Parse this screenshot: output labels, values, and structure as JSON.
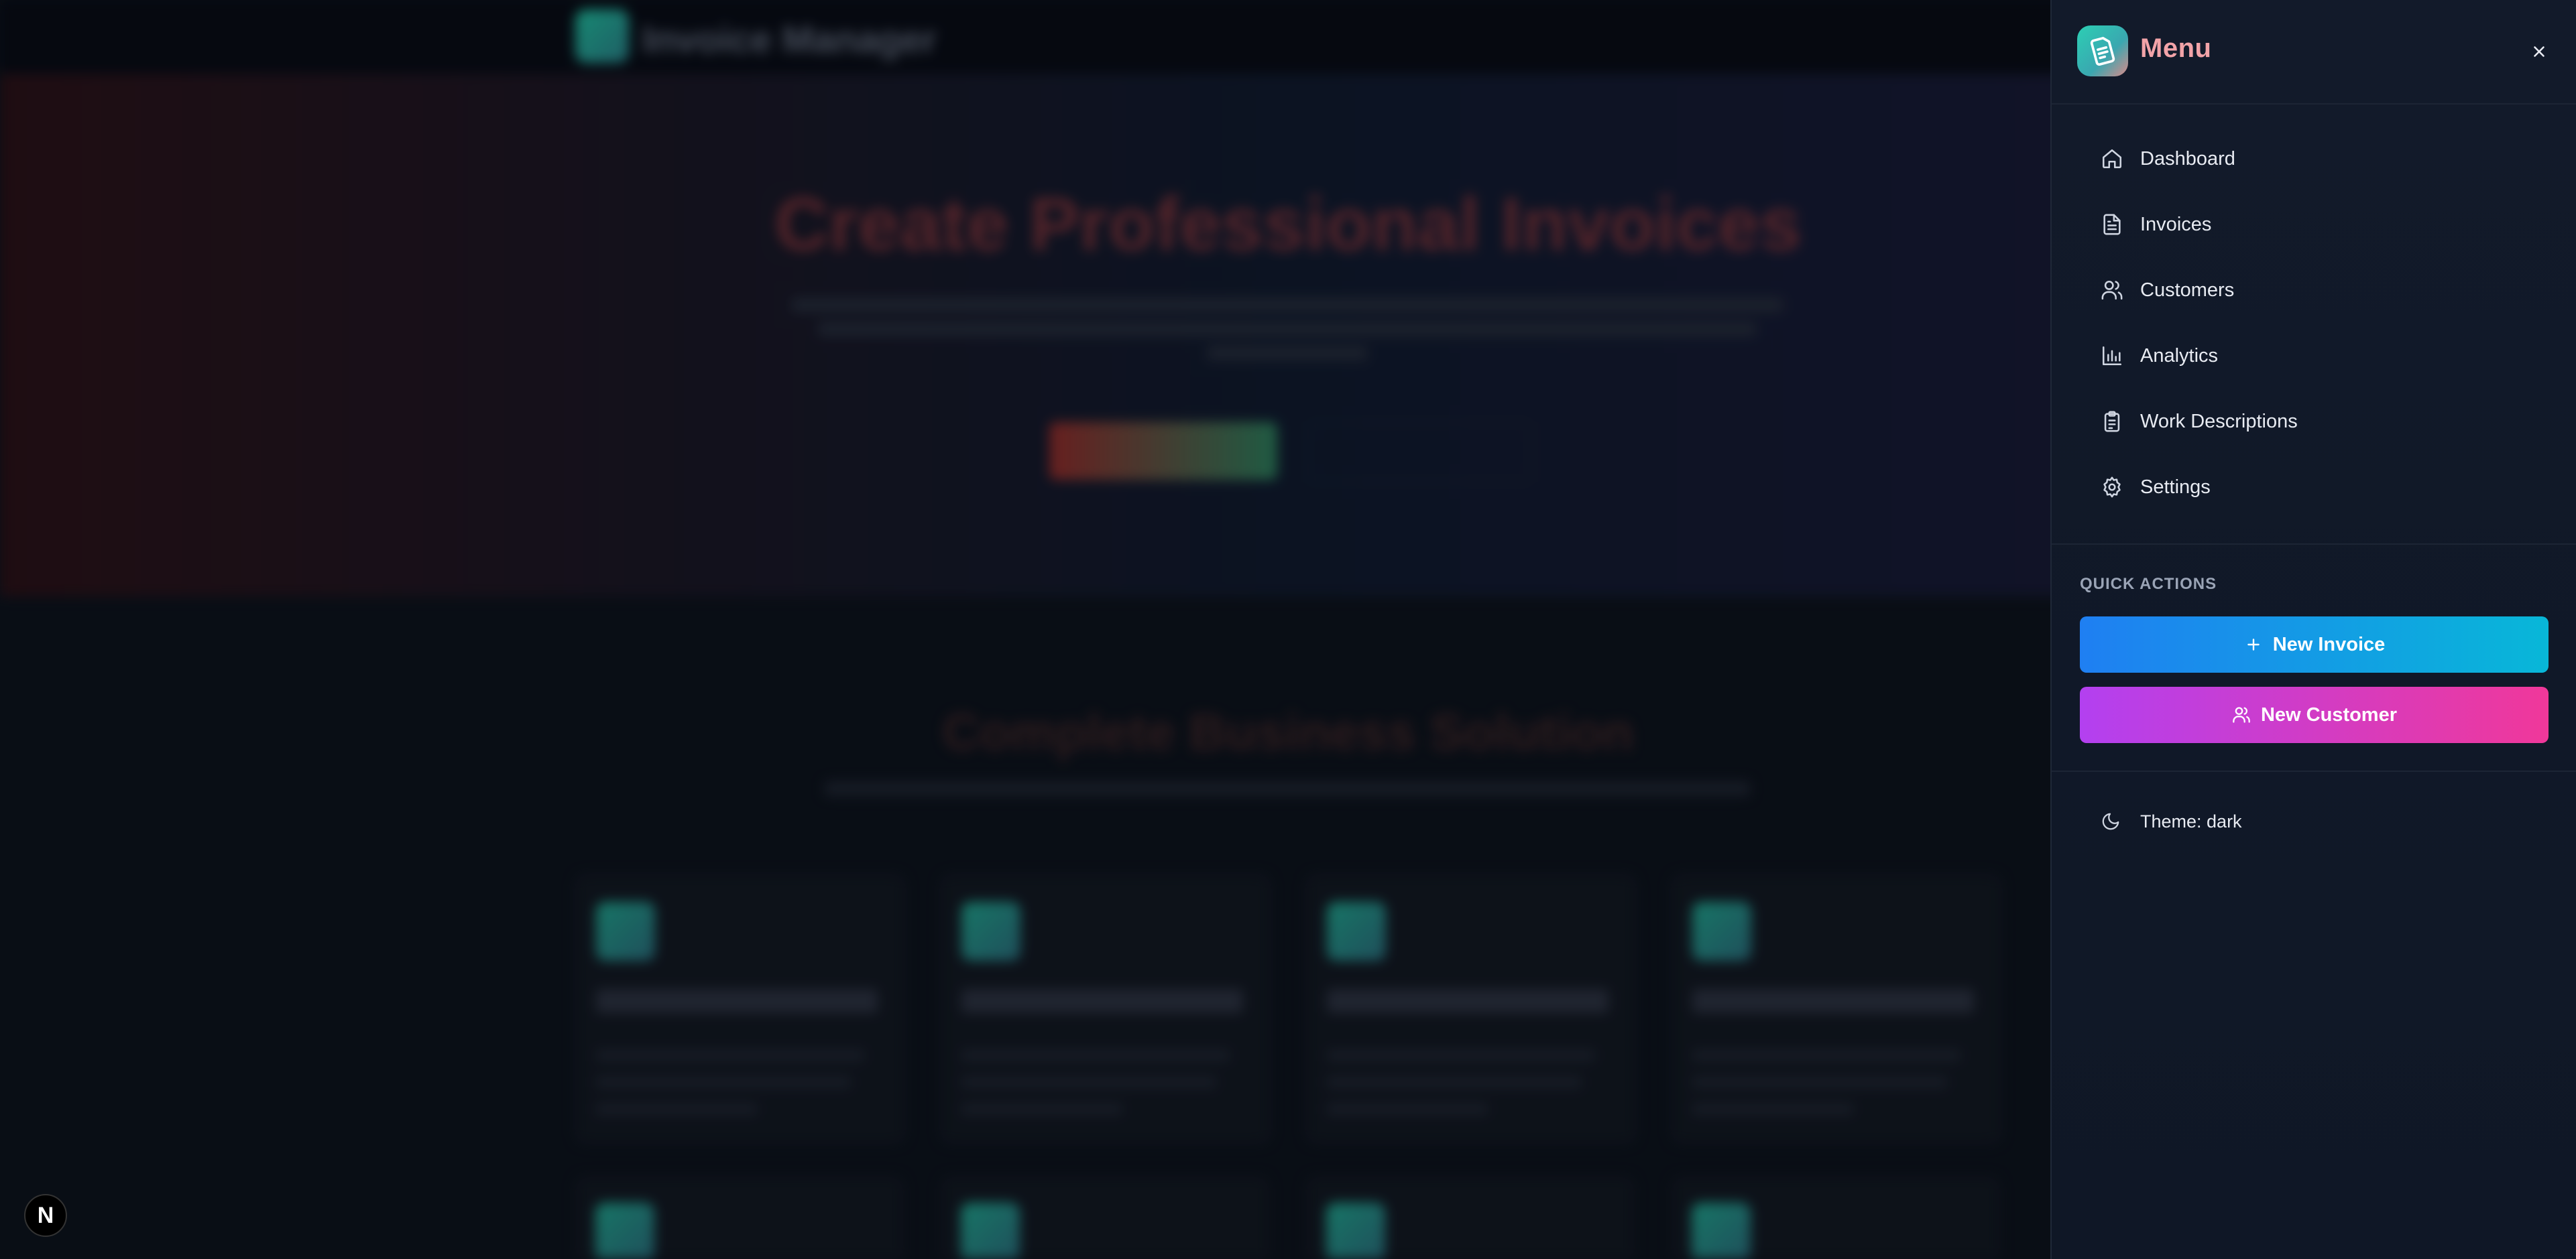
{
  "background": {
    "brand": "Invoice Manager",
    "hero_title": "Create Professional Invoices",
    "section_title": "Complete Business Solution"
  },
  "drawer": {
    "title": "Menu",
    "close_icon": "close-icon",
    "nav_items": [
      {
        "label": "Dashboard",
        "icon": "home-icon"
      },
      {
        "label": "Invoices",
        "icon": "file-text-icon"
      },
      {
        "label": "Customers",
        "icon": "users-icon"
      },
      {
        "label": "Analytics",
        "icon": "bar-chart-icon"
      },
      {
        "label": "Work Descriptions",
        "icon": "clipboard-icon"
      },
      {
        "label": "Settings",
        "icon": "gear-icon"
      }
    ],
    "quick_actions_label": "QUICK ACTIONS",
    "new_invoice_label": "New Invoice",
    "new_customer_label": "New Customer",
    "theme_label": "Theme: dark"
  },
  "badge": {
    "letter": "N"
  },
  "colors": {
    "accent_menu": "#f2a3a8",
    "new_invoice_gradient": [
      "#1f7ff2",
      "#08b7d8"
    ],
    "new_customer_gradient": [
      "#b340f0",
      "#f0389a"
    ],
    "drawer_bg": "#121a2a"
  }
}
